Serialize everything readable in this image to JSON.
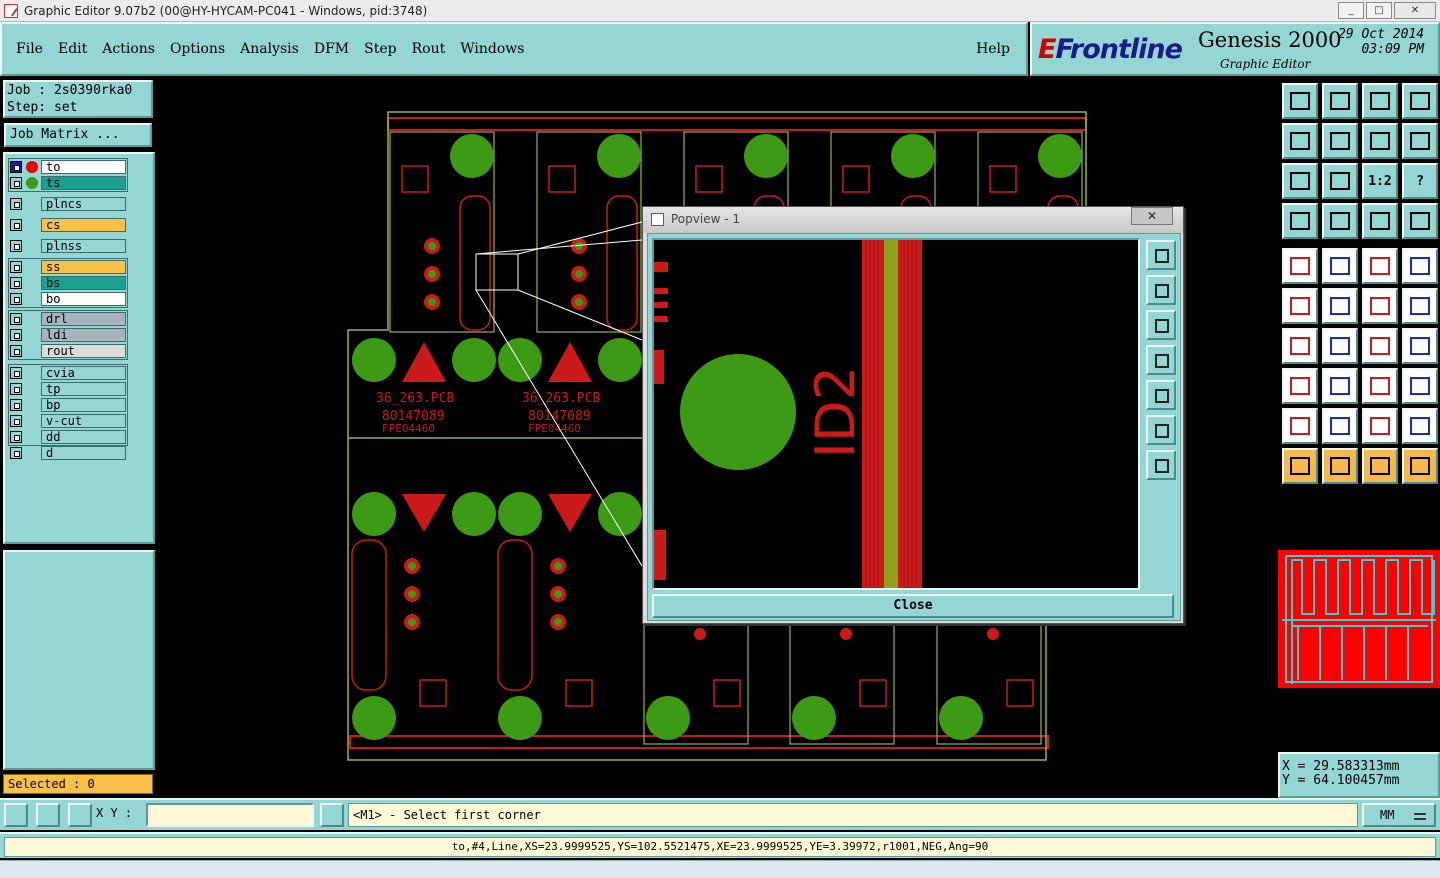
{
  "window": {
    "title": "Graphic Editor 9.07b2 (00@HY-HYCAM-PC041 - Windows, pid:3748)"
  },
  "menu": {
    "items": [
      "File",
      "Edit",
      "Actions",
      "Options",
      "Analysis",
      "DFM",
      "Step",
      "Rout",
      "Windows"
    ],
    "help": "Help"
  },
  "brand": {
    "logo_e": "E",
    "logo_rest": "Frontline",
    "product": "Genesis 2000",
    "subtitle": "Graphic Editor",
    "date": "29 Oct 2014",
    "time": "03:09 PM"
  },
  "job": {
    "job_line": "Job : 2s0390rka0",
    "step_line": "Step: set",
    "job_matrix": "Job Matrix ..."
  },
  "layers": [
    "to",
    "ts",
    "plncs",
    "cs",
    "plnss",
    "ss",
    "bs",
    "bo",
    "drl",
    "ldi",
    "rout",
    "cvia",
    "tp",
    "bp",
    "v-cut",
    "dd",
    "d"
  ],
  "colors": {
    "accent": "#94d6d4",
    "copper": "#cc1a1a",
    "pad": "#3d9a14",
    "profile": "#9ab43a",
    "selected": "#f7c14a"
  },
  "selected": "Selected : 0",
  "coords": {
    "x": "X = 29.583313mm",
    "y": "Y = 64.100457mm"
  },
  "xy_label": "X Y :",
  "message": "<M1> - Select first corner",
  "units": "MM",
  "status": "to,#4,Line,XS=23.9999525,YS=102.5521475,XE=23.9999525,YE=3.39972,r1001,NEG,Ang=90",
  "popup": {
    "title": "Popview - 1",
    "close": "Close",
    "view_label": "ID2"
  },
  "board": {
    "pcb_label": "36_263.PCB",
    "pn_label": "80147089",
    "fpe_label": "FPE04460"
  }
}
